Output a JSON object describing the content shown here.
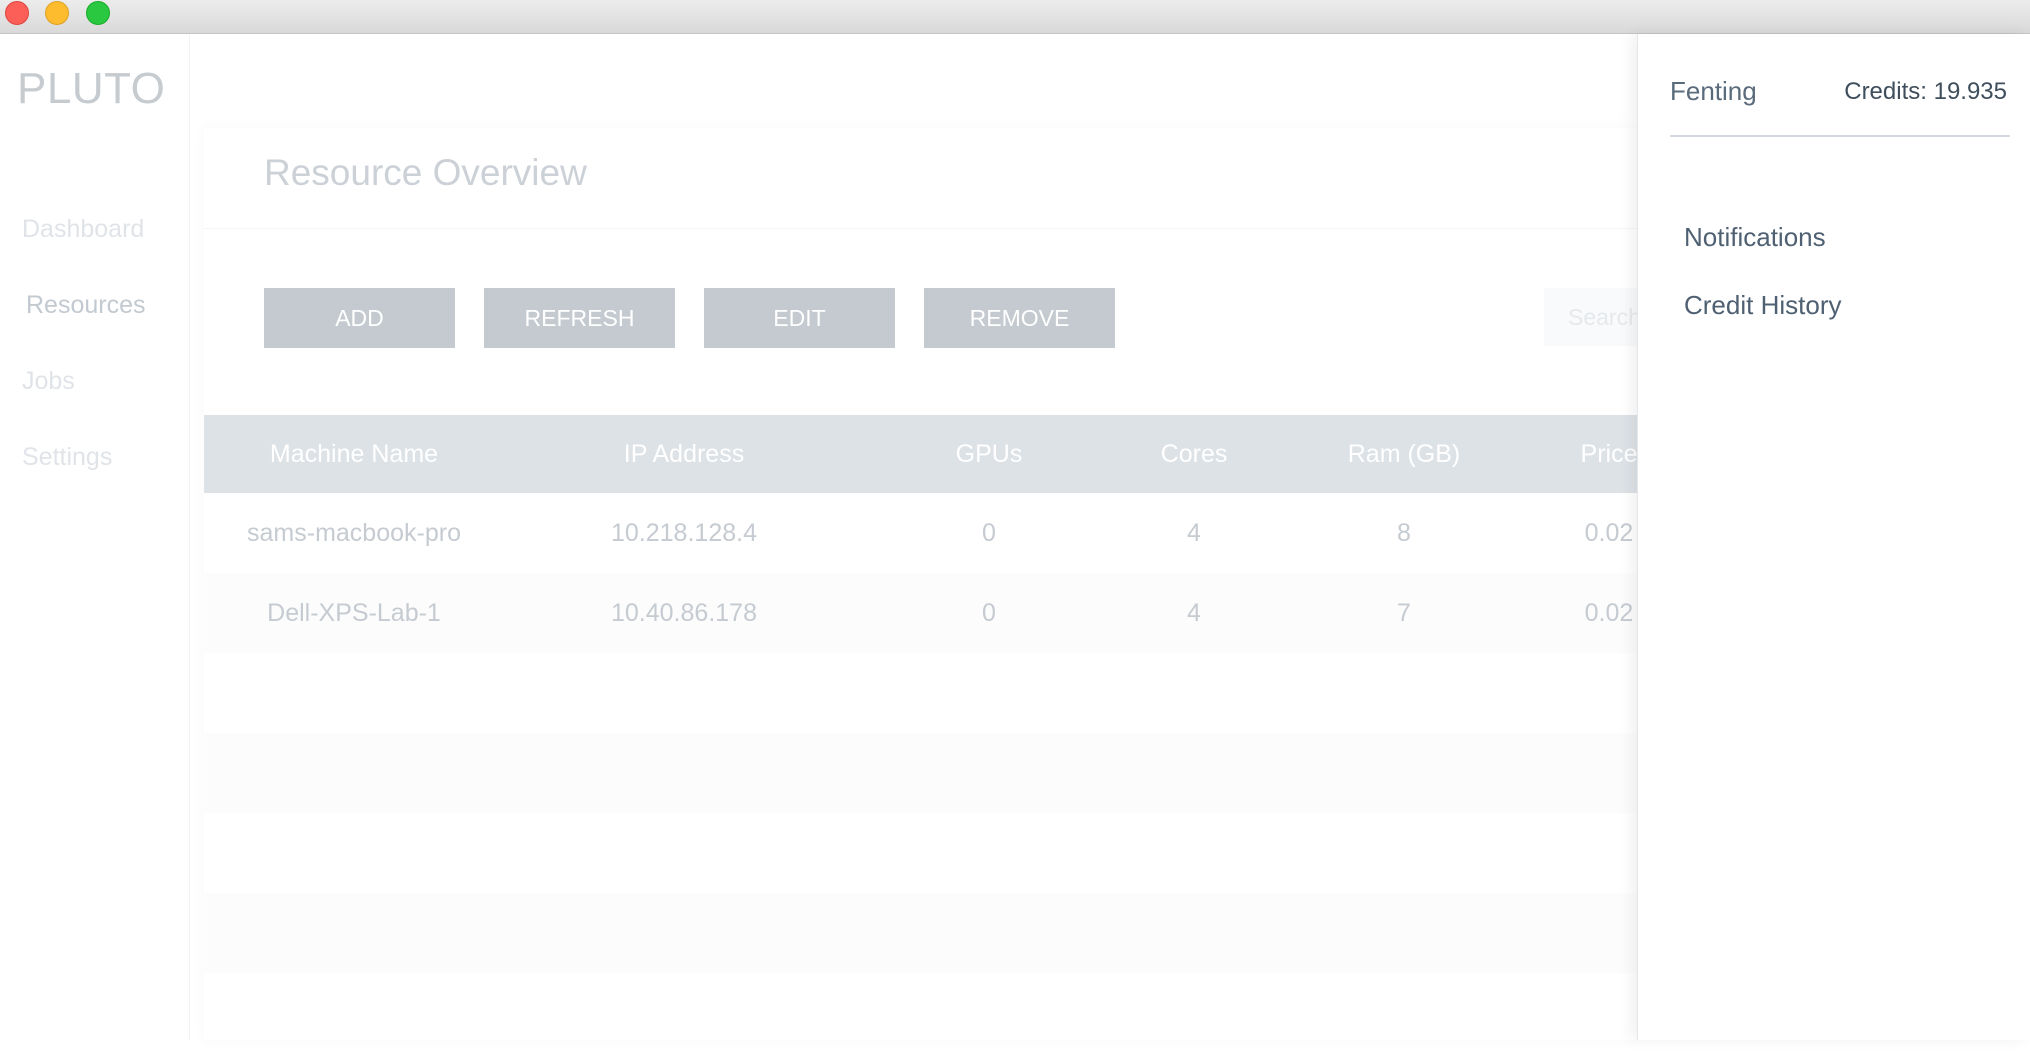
{
  "window": {
    "controls": [
      "close-button",
      "minimize-button",
      "maximize-button"
    ]
  },
  "sidebar": {
    "logo": "PLUTO",
    "items": [
      {
        "label": "Dashboard"
      },
      {
        "label": "Resources"
      },
      {
        "label": "Jobs"
      },
      {
        "label": "Settings"
      }
    ],
    "active": "Resources"
  },
  "main": {
    "title": "Resource Overview",
    "buttons": {
      "add": "ADD",
      "refresh": "REFRESH",
      "edit": "EDIT",
      "remove": "REMOVE"
    },
    "search": {
      "placeholder": "Search"
    },
    "table": {
      "columns": [
        "Machine Name",
        "IP Address",
        "GPUs",
        "Cores",
        "Ram (GB)",
        "Price"
      ],
      "rows": [
        [
          "sams-macbook-pro",
          "10.218.128.4",
          "0",
          "4",
          "8",
          "0.02"
        ],
        [
          "Dell-XPS-Lab-1",
          "10.40.86.178",
          "0",
          "4",
          "7",
          "0.02"
        ]
      ]
    }
  },
  "drawer": {
    "user": "Fenting",
    "credits": "Credits: 19.935",
    "links": [
      "Notifications",
      "Credit History"
    ]
  },
  "colors": {
    "button_bg": "#c4cad0",
    "table_header_bg": "#dde2e7",
    "drawer_text": "#4e6072"
  }
}
